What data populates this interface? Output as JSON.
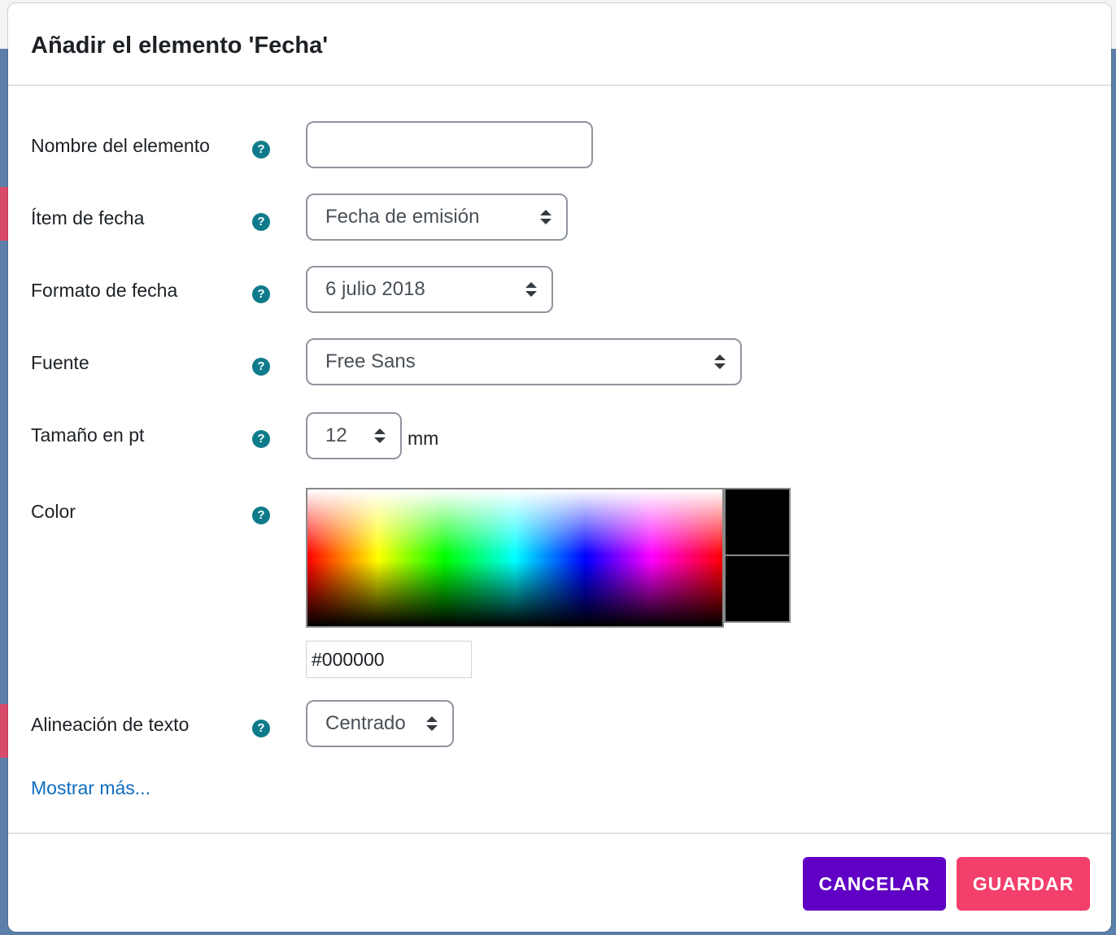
{
  "dialog": {
    "title": "Añadir el elemento 'Fecha'"
  },
  "form": {
    "element_name": {
      "label": "Nombre del elemento",
      "value": ""
    },
    "date_item": {
      "label": "Ítem de fecha",
      "selected": "Fecha de emisión"
    },
    "date_format": {
      "label": "Formato de fecha",
      "selected": "6 julio 2018"
    },
    "font": {
      "label": "Fuente",
      "selected": "Free Sans"
    },
    "size": {
      "label": "Tamaño en pt",
      "selected": "12",
      "unit": "mm"
    },
    "color": {
      "label": "Color",
      "hex_value": "#000000",
      "swatch_color": "#000000"
    },
    "alignment": {
      "label": "Alineación de texto",
      "selected": "Centrado"
    },
    "help_glyph": "?",
    "show_more": "Mostrar más..."
  },
  "footer": {
    "cancel_label": "CANCELAR",
    "save_label": "GUARDAR"
  },
  "colors": {
    "accent_cancel": "#6000c4",
    "accent_save": "#f33f6b",
    "help_icon": "#0f7b8a",
    "link": "#0f6cbf"
  },
  "icons": {
    "help": "question-circle-icon",
    "select_arrows": "sort-arrows-icon"
  }
}
